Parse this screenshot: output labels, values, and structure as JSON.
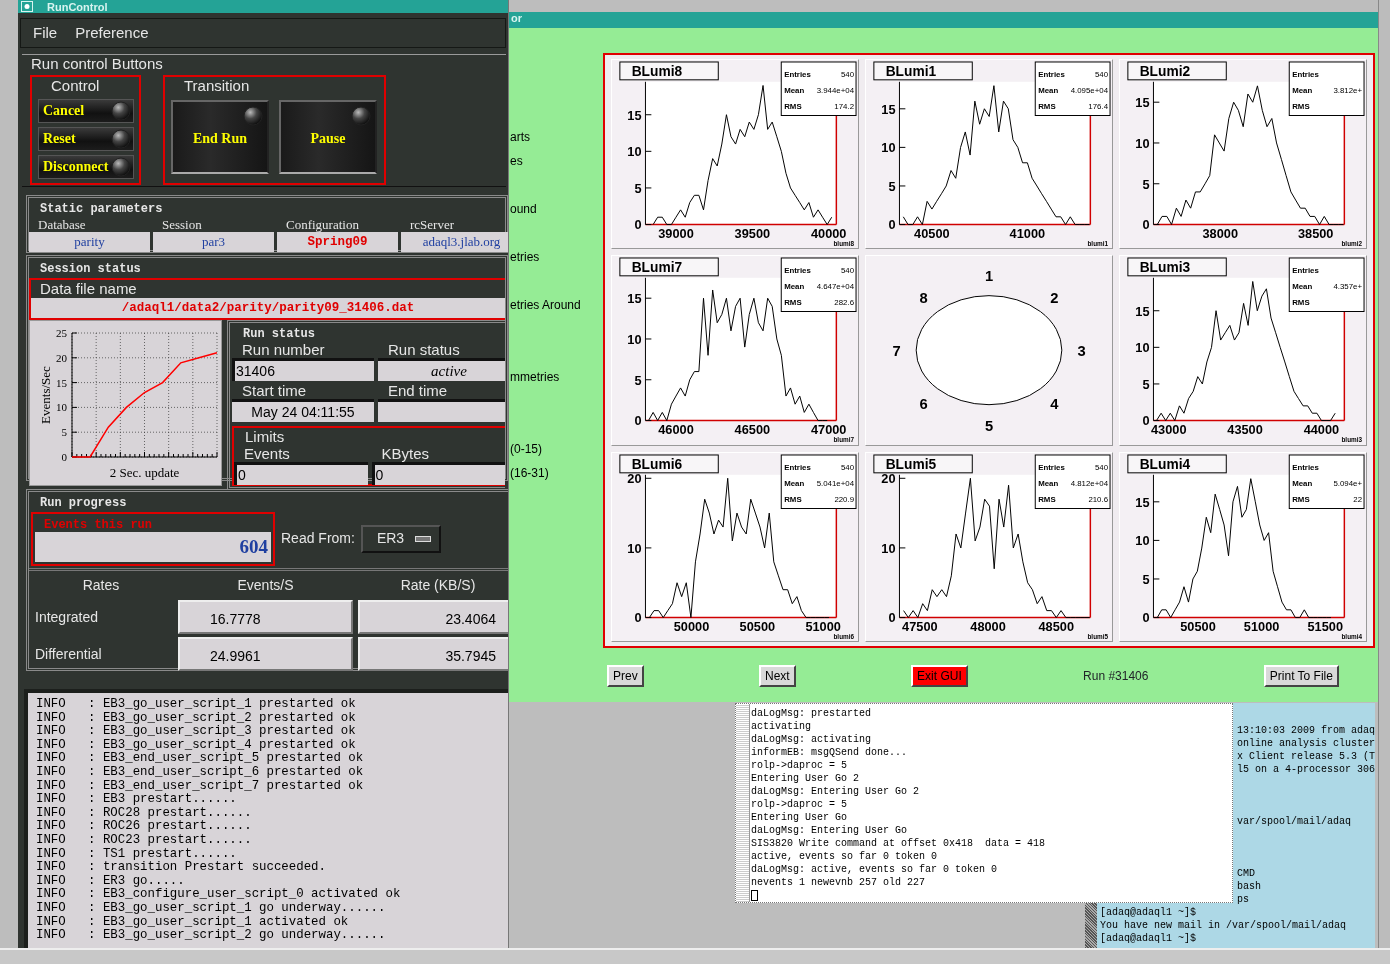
{
  "run_control": {
    "title": "RunControl",
    "menu": [
      "File",
      "Preference"
    ],
    "buttons_title": "Run control Buttons",
    "control_group": {
      "title": "Control",
      "buttons": [
        "Cancel",
        "Reset",
        "Disconnect"
      ]
    },
    "transition_group": {
      "title": "Transition",
      "buttons": [
        "End Run",
        "Pause"
      ]
    },
    "static_parameters": {
      "title": "Static parameters",
      "fields": [
        {
          "label": "Database",
          "value": "parity",
          "kind": "normal"
        },
        {
          "label": "Session",
          "value": "par3",
          "kind": "normal"
        },
        {
          "label": "Configuration",
          "value": "Spring09",
          "kind": "highlight"
        },
        {
          "label": "rcServer",
          "value": "adaql3.jlab.org",
          "kind": "normal"
        }
      ]
    },
    "session_status": {
      "title": "Session status",
      "data_file_label": "Data file name",
      "data_file": "/adaql1/data2/parity/parity09_31406.dat"
    },
    "rate_chart": {
      "chart_data": {
        "type": "line",
        "xlabel": "2 Sec. update",
        "ylabel": "Events/Sec",
        "ylim": [
          0,
          25
        ],
        "yticks": [
          0,
          5,
          10,
          15,
          20,
          25
        ],
        "grid": true,
        "categories": [
          null,
          null,
          null,
          null,
          null,
          null,
          null,
          null,
          null
        ],
        "values": [
          0,
          0,
          6,
          10,
          13,
          15,
          19,
          20,
          21
        ]
      }
    },
    "run_status": {
      "title": "Run status",
      "fields": [
        {
          "label": "Run number",
          "value": "31406",
          "kind": "input"
        },
        {
          "label": "Run status",
          "value": "active",
          "kind": "status"
        },
        {
          "label": "Start time",
          "value": "May 24 04:11:55",
          "kind": "display"
        },
        {
          "label": "End time",
          "kind": "display"
        }
      ],
      "limits": {
        "title": "Limits",
        "fields": [
          {
            "label": "Events",
            "value": "0"
          },
          {
            "label": "KBytes",
            "value": "0"
          }
        ]
      }
    },
    "run_progress": {
      "title": "Run progress",
      "events_label": "Events this run",
      "events_value": "604",
      "read_from_label": "Read From:",
      "read_from_value": "ER3"
    },
    "rates": {
      "columns": [
        "Rates",
        "Events/S",
        "Rate (KB/S)"
      ],
      "rows": [
        {
          "label": "Integrated",
          "values": [
            "16.7778",
            "23.4064"
          ]
        },
        {
          "label": "Differential",
          "values": [
            "24.9961",
            "35.7945"
          ]
        }
      ]
    },
    "log": [
      "INFO   : EB3_go_user_script_1 prestarted ok",
      "INFO   : EB3_go_user_script_2 prestarted ok",
      "INFO   : EB3_go_user_script_3 prestarted ok",
      "INFO   : EB3_go_user_script_4 prestarted ok",
      "INFO   : EB3_end_user_script_5 prestarted ok",
      "INFO   : EB3_end_user_script_6 prestarted ok",
      "INFO   : EB3_end_user_script_7 prestarted ok",
      "INFO   : EB3 prestart......",
      "INFO   : ROC28 prestart......",
      "INFO   : ROC26 prestart......",
      "INFO   : ROC23 prestart......",
      "INFO   : TS1 prestart......",
      "INFO   : transition Prestart succeeded.",
      "INFO   : ER3 go.....",
      "INFO   : EB3_configure_user_script_0 activated ok",
      "INFO   : EB3_go_user_script_1 go underway......",
      "INFO   : EB3_go_user_script_1 activated ok",
      "INFO   : EB3_go_user_script_2 go underway......"
    ]
  },
  "monitor": {
    "title": "or",
    "side_labels": [
      "arts",
      "es",
      "ound",
      "etries",
      "etries Around",
      "mmetries",
      "(0-15)",
      "(16-31)"
    ],
    "pads": [
      {
        "kind": "histogram",
        "title": "BLumi8",
        "stats": [
          {
            "label": "Entries",
            "value": "540"
          },
          {
            "label": "Mean",
            "value": "3.944e+04"
          },
          {
            "label": "RMS",
            "value": "174.2"
          }
        ],
        "chart_data": {
          "type": "line",
          "xlabel": "blumi8",
          "xlim": [
            38800,
            40050
          ],
          "ylim": [
            0,
            19.5
          ],
          "xticks": [
            39000,
            39500,
            40000
          ],
          "yticks": [
            0,
            5,
            10,
            15
          ],
          "x": [
            38850,
            38880,
            38910,
            38940,
            38970,
            39000,
            39030,
            39060,
            39090,
            39120,
            39150,
            39180,
            39210,
            39240,
            39270,
            39300,
            39330,
            39360,
            39390,
            39420,
            39450,
            39480,
            39510,
            39540,
            39570,
            39600,
            39630,
            39660,
            39690,
            39720,
            39750,
            39780,
            39810,
            39840,
            39870,
            39900,
            39930,
            39960,
            39990,
            40020
          ],
          "values": [
            0,
            1,
            1,
            0,
            0,
            1,
            2,
            1,
            3,
            4,
            4,
            2,
            6,
            9,
            8,
            11,
            15,
            12,
            11,
            13,
            12,
            14,
            13,
            15,
            19,
            13,
            14,
            12,
            10,
            7,
            5,
            4,
            3,
            2,
            3,
            1,
            2,
            1,
            0,
            1
          ]
        }
      },
      {
        "kind": "histogram",
        "title": "BLumi1",
        "stats": [
          {
            "label": "Entries",
            "value": "540"
          },
          {
            "label": "Mean",
            "value": "4.095e+04"
          },
          {
            "label": "RMS",
            "value": "176.4"
          }
        ],
        "chart_data": {
          "type": "line",
          "xlabel": "blumi1",
          "xlim": [
            40330,
            41330
          ],
          "ylim": [
            0,
            18.5
          ],
          "xticks": [
            40500,
            41000
          ],
          "yticks": [
            0,
            5,
            10,
            15
          ],
          "x": [
            40350,
            40375,
            40400,
            40425,
            40450,
            40475,
            40500,
            40525,
            40550,
            40575,
            40600,
            40625,
            40650,
            40675,
            40700,
            40725,
            40750,
            40775,
            40800,
            40825,
            40850,
            40875,
            40900,
            40925,
            40950,
            40975,
            41000,
            41025,
            41050,
            41075,
            41100,
            41125,
            41150,
            41175,
            41200,
            41225,
            41250,
            41275,
            41300,
            41325
          ],
          "values": [
            1,
            0,
            0,
            1,
            0,
            3,
            2,
            3,
            4,
            5,
            7,
            6,
            10,
            12,
            9,
            16,
            13,
            15,
            14,
            18,
            12,
            16,
            15,
            11,
            10,
            8,
            8,
            6,
            5,
            4,
            3,
            2,
            1,
            1,
            0,
            1,
            0,
            0,
            0,
            0
          ]
        }
      },
      {
        "kind": "histogram",
        "title": "BLumi2",
        "stats": [
          {
            "label": "Entries"
          },
          {
            "label": "Mean",
            "value": "3.812e+"
          },
          {
            "label": "RMS"
          }
        ],
        "chart_data": {
          "type": "line",
          "xlabel": "blumi2",
          "xlim": [
            37650,
            38650
          ],
          "ylim": [
            0,
            17.5
          ],
          "xticks": [
            38000,
            38500
          ],
          "yticks": [
            0,
            5,
            10,
            15
          ],
          "x": [
            37670,
            37695,
            37720,
            37745,
            37770,
            37795,
            37820,
            37845,
            37870,
            37895,
            37920,
            37945,
            37970,
            37995,
            38020,
            38045,
            38070,
            38095,
            38120,
            38145,
            38170,
            38195,
            38220,
            38245,
            38270,
            38295,
            38320,
            38345,
            38370,
            38395,
            38420,
            38445,
            38470,
            38495,
            38520,
            38545,
            38570,
            38595,
            38620,
            38645
          ],
          "values": [
            0,
            1,
            1,
            0,
            2,
            1,
            3,
            2,
            4,
            4,
            5,
            6,
            11,
            10,
            9,
            13,
            15,
            14,
            12,
            16,
            15,
            17,
            14,
            12,
            13,
            10,
            8,
            6,
            4,
            3,
            2,
            2,
            1,
            1,
            0,
            1,
            0,
            0,
            0,
            0
          ]
        }
      },
      {
        "kind": "histogram",
        "title": "BLumi7",
        "stats": [
          {
            "label": "Entries",
            "value": "540"
          },
          {
            "label": "Mean",
            "value": "4.647e+04"
          },
          {
            "label": "RMS",
            "value": "282.6"
          }
        ],
        "chart_data": {
          "type": "line",
          "xlabel": "blumi7",
          "xlim": [
            45800,
            47050
          ],
          "ylim": [
            0,
            17.5
          ],
          "xticks": [
            46000,
            46500,
            47000
          ],
          "yticks": [
            0,
            5,
            10,
            15
          ],
          "x": [
            45820,
            45850,
            45880,
            45910,
            45940,
            45970,
            46000,
            46030,
            46060,
            46090,
            46120,
            46150,
            46180,
            46210,
            46240,
            46270,
            46300,
            46330,
            46360,
            46390,
            46420,
            46450,
            46480,
            46510,
            46540,
            46570,
            46600,
            46630,
            46660,
            46690,
            46720,
            46750,
            46780,
            46810,
            46840,
            46870,
            46900,
            46930,
            46960,
            46990
          ],
          "values": [
            0,
            1,
            0,
            1,
            0,
            2,
            3,
            4,
            3,
            5,
            6,
            6,
            15,
            8,
            16,
            12,
            13,
            15,
            11,
            14,
            15,
            9,
            13,
            15,
            12,
            11,
            15,
            14,
            10,
            8,
            3,
            4,
            2,
            3,
            1,
            2,
            1,
            0,
            0,
            0
          ]
        }
      },
      {
        "kind": "ring",
        "labels": [
          "1",
          "2",
          "3",
          "4",
          "5",
          "6",
          "7",
          "8"
        ]
      },
      {
        "kind": "histogram",
        "title": "BLumi3",
        "stats": [
          {
            "label": "Entries"
          },
          {
            "label": "Mean",
            "value": "4.357e+"
          },
          {
            "label": "RMS"
          }
        ],
        "chart_data": {
          "type": "line",
          "xlabel": "blumi3",
          "xlim": [
            42900,
            44150
          ],
          "ylim": [
            0,
            19.5
          ],
          "xticks": [
            43000,
            43500,
            44000
          ],
          "yticks": [
            0,
            5,
            10,
            15
          ],
          "x": [
            42920,
            42950,
            42980,
            43010,
            43040,
            43070,
            43100,
            43130,
            43160,
            43190,
            43220,
            43250,
            43280,
            43310,
            43340,
            43370,
            43400,
            43430,
            43460,
            43490,
            43520,
            43550,
            43580,
            43610,
            43640,
            43670,
            43700,
            43730,
            43760,
            43790,
            43820,
            43850,
            43880,
            43910,
            43940,
            43970,
            44000,
            44030,
            44060,
            44090
          ],
          "values": [
            0,
            1,
            0,
            1,
            0,
            2,
            1,
            3,
            4,
            6,
            5,
            8,
            10,
            15,
            11,
            12,
            13,
            11,
            12,
            16,
            13,
            19,
            15,
            17,
            18,
            14,
            12,
            10,
            8,
            6,
            4,
            3,
            2,
            2,
            1,
            1,
            0,
            0,
            0,
            1
          ]
        }
      },
      {
        "kind": "histogram",
        "title": "BLumi6",
        "stats": [
          {
            "label": "Entries",
            "value": "540"
          },
          {
            "label": "Mean",
            "value": "5.041e+04"
          },
          {
            "label": "RMS",
            "value": "220.9"
          }
        ],
        "chart_data": {
          "type": "line",
          "xlabel": "blumi6",
          "xlim": [
            49650,
            51100
          ],
          "ylim": [
            0,
            20.5
          ],
          "xticks": [
            50000,
            50500,
            51000
          ],
          "yticks": [
            0,
            10,
            20
          ],
          "x": [
            49680,
            49715,
            49750,
            49785,
            49820,
            49855,
            49890,
            49925,
            49960,
            49995,
            50030,
            50065,
            50100,
            50135,
            50170,
            50205,
            50240,
            50275,
            50310,
            50345,
            50380,
            50415,
            50450,
            50485,
            50520,
            50555,
            50590,
            50625,
            50660,
            50695,
            50730,
            50765,
            50800,
            50835,
            50870,
            50905,
            50940,
            50975,
            51010,
            51045
          ],
          "values": [
            0,
            1,
            1,
            0,
            1,
            2,
            5,
            3,
            5,
            0,
            8,
            12,
            17,
            15,
            12,
            14,
            13,
            20,
            11,
            15,
            13,
            12,
            17,
            15,
            13,
            10,
            15,
            8,
            6,
            4,
            4,
            2,
            3,
            1,
            0,
            0,
            0,
            0,
            0,
            0
          ]
        }
      },
      {
        "kind": "histogram",
        "title": "BLumi5",
        "stats": [
          {
            "label": "Entries",
            "value": "540"
          },
          {
            "label": "Mean",
            "value": "4.812e+04"
          },
          {
            "label": "RMS",
            "value": "210.6"
          }
        ],
        "chart_data": {
          "type": "line",
          "xlabel": "blumi5",
          "xlim": [
            47350,
            48750
          ],
          "ylim": [
            0,
            20.5
          ],
          "xticks": [
            47500,
            48000,
            48500
          ],
          "yticks": [
            0,
            10,
            20
          ],
          "x": [
            47380,
            47415,
            47450,
            47485,
            47520,
            47555,
            47590,
            47625,
            47660,
            47695,
            47730,
            47765,
            47800,
            47835,
            47870,
            47905,
            47940,
            47975,
            48010,
            48045,
            48080,
            48115,
            48150,
            48185,
            48220,
            48255,
            48290,
            48325,
            48360,
            48395,
            48430,
            48465,
            48500,
            48535,
            48570,
            48605,
            48640,
            48675,
            48710,
            48745
          ],
          "values": [
            1,
            0,
            1,
            0,
            2,
            1,
            4,
            3,
            4,
            3,
            6,
            12,
            10,
            15,
            20,
            11,
            13,
            17,
            16,
            7,
            17,
            13,
            19,
            10,
            12,
            8,
            5,
            4,
            2,
            3,
            1,
            1,
            0,
            1,
            0,
            0,
            0,
            0,
            0,
            0
          ]
        }
      },
      {
        "kind": "histogram",
        "title": "BLumi4",
        "stats": [
          {
            "label": "Entries"
          },
          {
            "label": "Mean",
            "value": "5.094e+"
          },
          {
            "label": "RMS",
            "value": "22"
          }
        ],
        "chart_data": {
          "type": "line",
          "xlabel": "blumi4",
          "xlim": [
            50150,
            51650
          ],
          "ylim": [
            0,
            18.5
          ],
          "xticks": [
            50500,
            51000,
            51500
          ],
          "yticks": [
            0,
            5,
            10,
            15
          ],
          "x": [
            50180,
            50215,
            50250,
            50285,
            50320,
            50355,
            50390,
            50425,
            50460,
            50495,
            50530,
            50565,
            50600,
            50635,
            50670,
            50705,
            50740,
            50775,
            50810,
            50845,
            50880,
            50915,
            50950,
            50985,
            51020,
            51055,
            51090,
            51125,
            51160,
            51195,
            51230,
            51265,
            51300,
            51335,
            51370,
            51405,
            51440,
            51475,
            51510,
            51545
          ],
          "values": [
            0,
            1,
            1,
            0,
            1,
            2,
            4,
            2,
            5,
            6,
            9,
            13,
            11,
            16,
            14,
            12,
            8,
            15,
            17,
            13,
            14,
            18,
            15,
            12,
            10,
            11,
            6,
            4,
            2,
            1,
            1,
            0,
            0,
            1,
            0,
            0,
            0,
            0,
            0,
            0
          ]
        }
      }
    ],
    "buttons": [
      {
        "label": "Prev",
        "kind": "normal"
      },
      {
        "label": "Next",
        "kind": "normal"
      },
      {
        "label": "Exit GUI",
        "kind": "danger"
      }
    ],
    "run_label": "Run #31406",
    "print_button": "Print To File"
  },
  "message_log": [
    "daLogMsg: prestarted",
    "activating",
    "daLogMsg: activating",
    "informEB: msgQSend done...",
    "rolp->daproc = 5",
    "Entering User Go 2",
    "daLogMsg: Entering User Go 2",
    "rolp->daproc = 5",
    "Entering User Go",
    "daLogMsg: Entering User Go",
    "SIS3820 Write command at offset 0x418  data = 418",
    "active, events so far 0 token 0",
    "daLogMsg: active, events so far 0 token 0",
    "nevents 1 newevnb 257 old 227"
  ],
  "terminal": {
    "upper_lines": [
      "13:10:03 2009 from adaq",
      "online analysis cluster",
      "x Client release 5.3 (T",
      "l5 on a 4-processor 306",
      "var/spool/mail/adaq",
      "CMD",
      "bash",
      "ps"
    ],
    "lower_lines": [
      "[adaq@adaql1 ~]$",
      "You have new mail in /var/spool/mail/adaq",
      "[adaq@adaql1 ~]$"
    ]
  }
}
